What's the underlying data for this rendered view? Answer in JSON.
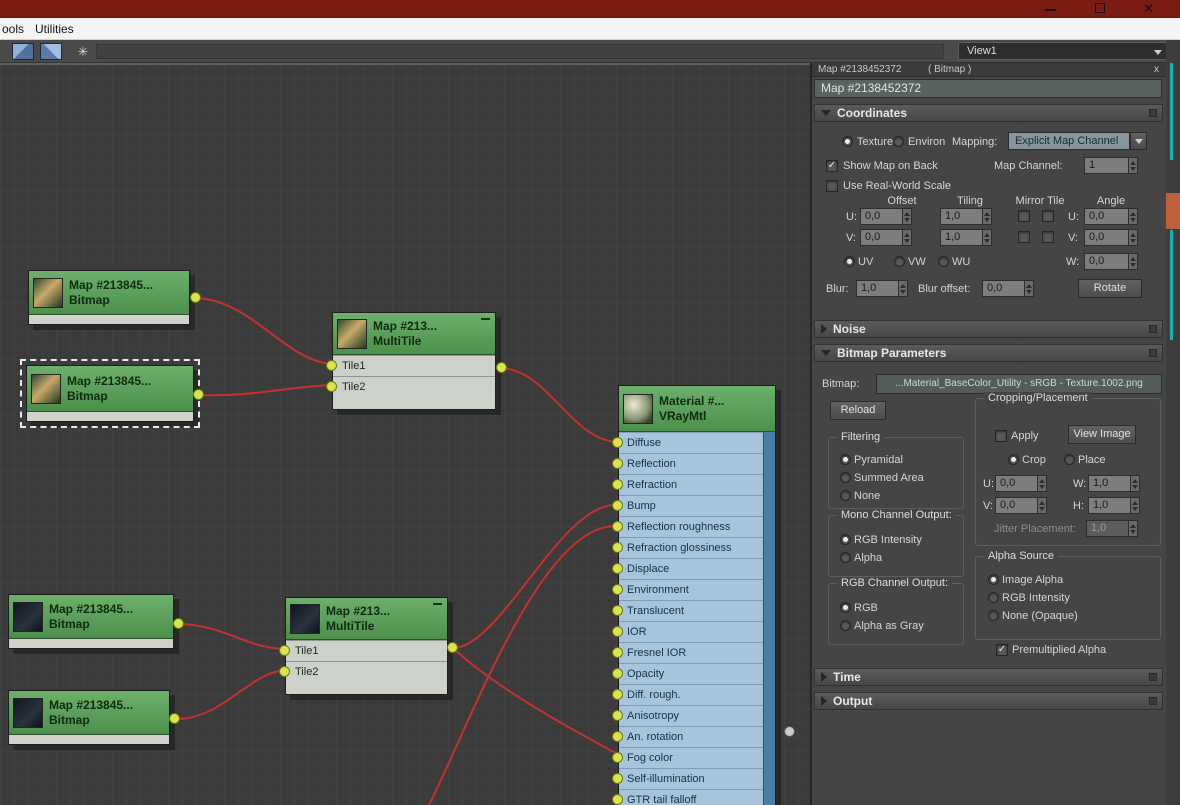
{
  "titlebar": {
    "close_glyph": "✕"
  },
  "menubar": {
    "items": [
      "ools",
      "Utilities"
    ]
  },
  "toolbar": {
    "view_label": "View1"
  },
  "icons": {
    "move_tool": "✳"
  },
  "colors": {
    "wire": "#c53131",
    "socket": "#d9e44e",
    "node_header_green": "#5ba45b",
    "vray_slot_blue": "#a6c4da",
    "titlebar_red": "#7a1b12",
    "accent_teal": "#18b2b2"
  },
  "graph": {
    "bitmap_nodes": [
      {
        "title": "Map #213845...",
        "subtitle": "Bitmap"
      },
      {
        "title": "Map #213845...",
        "subtitle": "Bitmap"
      },
      {
        "title": "Map #213845...",
        "subtitle": "Bitmap"
      },
      {
        "title": "Map #213845...",
        "subtitle": "Bitmap"
      }
    ],
    "multitile_nodes": [
      {
        "title": "Map #213...",
        "subtitle": "MultiTile",
        "slots": [
          "Tile1",
          "Tile2"
        ]
      },
      {
        "title": "Map #213...",
        "subtitle": "MultiTile",
        "slots": [
          "Tile1",
          "Tile2"
        ]
      }
    ],
    "vray_node": {
      "title": "Material #...",
      "subtitle": "VRayMtl",
      "slots": [
        "Diffuse",
        "Reflection",
        "Refraction",
        "Bump",
        "Reflection roughness",
        "Refraction glossiness",
        "Displace",
        "Environment",
        "Translucent",
        "IOR",
        "Fresnel IOR",
        "Opacity",
        "Diff. rough.",
        "Anisotropy",
        "An. rotation",
        "Fog color",
        "Self-illumination",
        "GTR tail falloff"
      ]
    }
  },
  "panel": {
    "header": {
      "title": "Map #2138452372",
      "type": "( Bitmap )",
      "close_glyph": "x"
    },
    "name_field": "Map #2138452372",
    "rollouts": {
      "coordinates": "Coordinates",
      "noise": "Noise",
      "bitmap_parameters": "Bitmap Parameters",
      "time": "Time",
      "output": "Output"
    },
    "coordinates": {
      "texture_label": "Texture",
      "environ_label": "Environ",
      "mapping_label": "Mapping:",
      "mapping_value": "Explicit Map Channel",
      "show_map_on_back": "Show Map on Back",
      "map_channel_label": "Map Channel:",
      "map_channel_value": "1",
      "use_real_world_scale": "Use Real-World Scale",
      "col_offset": "Offset",
      "col_tiling": "Tiling",
      "col_mirror_tile": "Mirror Tile",
      "col_angle": "Angle",
      "u_label": "U:",
      "v_label": "V:",
      "w_label": "W:",
      "offset_u": "0,0",
      "offset_v": "0,0",
      "tiling_u": "1,0",
      "tiling_v": "1,0",
      "angle_u": "0,0",
      "angle_v": "0,0",
      "angle_w": "0,0",
      "uv_label": "UV",
      "vw_label": "VW",
      "wu_label": "WU",
      "blur_label": "Blur:",
      "blur_value": "1,0",
      "blur_offset_label": "Blur offset:",
      "blur_offset_value": "0,0",
      "rotate_button": "Rotate"
    },
    "bitmap_params": {
      "bitmap_label": "Bitmap:",
      "bitmap_path": "...Material_BaseColor_Utility - sRGB - Texture.1002.png",
      "reload_button": "Reload",
      "cropping_group": "Cropping/Placement",
      "apply_label": "Apply",
      "view_image_button": "View Image",
      "crop_label": "Crop",
      "place_label": "Place",
      "u_label": "U:",
      "u_value": "0,0",
      "w_label": "W:",
      "w_value": "1,0",
      "v_label": "V:",
      "v_value": "0,0",
      "h_label": "H:",
      "h_value": "1,0",
      "jitter_label": "Jitter Placement:",
      "jitter_value": "1,0",
      "filtering_group": "Filtering",
      "filtering_options": [
        "Pyramidal",
        "Summed Area",
        "None"
      ],
      "mono_group": "Mono Channel Output:",
      "mono_options": [
        "RGB Intensity",
        "Alpha"
      ],
      "rgb_group": "RGB Channel Output:",
      "rgb_options": [
        "RGB",
        "Alpha as Gray"
      ],
      "alpha_group": "Alpha Source",
      "alpha_options": [
        "Image Alpha",
        "RGB Intensity",
        "None (Opaque)"
      ],
      "premultiplied": "Premultiplied Alpha"
    }
  }
}
